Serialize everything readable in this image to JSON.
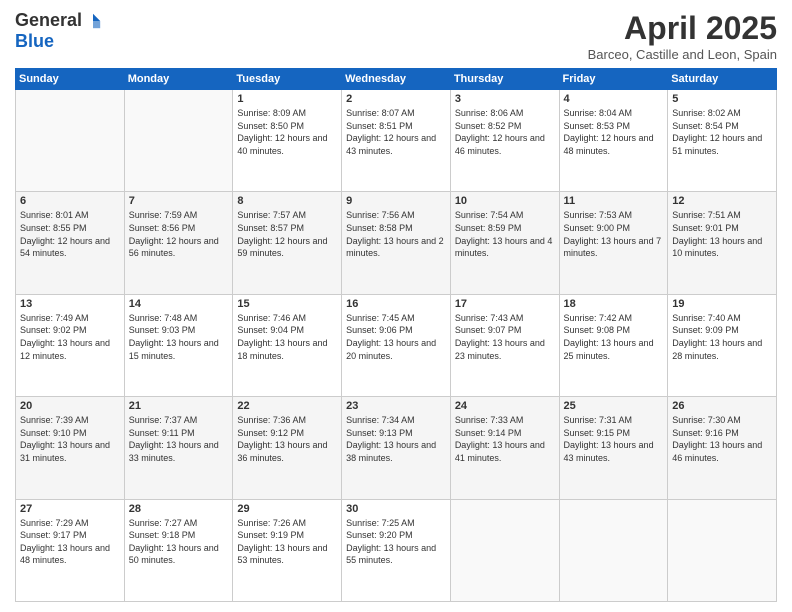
{
  "header": {
    "logo_general": "General",
    "logo_blue": "Blue",
    "title": "April 2025",
    "location": "Barceo, Castille and Leon, Spain"
  },
  "days_of_week": [
    "Sunday",
    "Monday",
    "Tuesday",
    "Wednesday",
    "Thursday",
    "Friday",
    "Saturday"
  ],
  "weeks": [
    [
      {
        "day": "",
        "info": ""
      },
      {
        "day": "",
        "info": ""
      },
      {
        "day": "1",
        "info": "Sunrise: 8:09 AM\nSunset: 8:50 PM\nDaylight: 12 hours and 40 minutes."
      },
      {
        "day": "2",
        "info": "Sunrise: 8:07 AM\nSunset: 8:51 PM\nDaylight: 12 hours and 43 minutes."
      },
      {
        "day": "3",
        "info": "Sunrise: 8:06 AM\nSunset: 8:52 PM\nDaylight: 12 hours and 46 minutes."
      },
      {
        "day": "4",
        "info": "Sunrise: 8:04 AM\nSunset: 8:53 PM\nDaylight: 12 hours and 48 minutes."
      },
      {
        "day": "5",
        "info": "Sunrise: 8:02 AM\nSunset: 8:54 PM\nDaylight: 12 hours and 51 minutes."
      }
    ],
    [
      {
        "day": "6",
        "info": "Sunrise: 8:01 AM\nSunset: 8:55 PM\nDaylight: 12 hours and 54 minutes."
      },
      {
        "day": "7",
        "info": "Sunrise: 7:59 AM\nSunset: 8:56 PM\nDaylight: 12 hours and 56 minutes."
      },
      {
        "day": "8",
        "info": "Sunrise: 7:57 AM\nSunset: 8:57 PM\nDaylight: 12 hours and 59 minutes."
      },
      {
        "day": "9",
        "info": "Sunrise: 7:56 AM\nSunset: 8:58 PM\nDaylight: 13 hours and 2 minutes."
      },
      {
        "day": "10",
        "info": "Sunrise: 7:54 AM\nSunset: 8:59 PM\nDaylight: 13 hours and 4 minutes."
      },
      {
        "day": "11",
        "info": "Sunrise: 7:53 AM\nSunset: 9:00 PM\nDaylight: 13 hours and 7 minutes."
      },
      {
        "day": "12",
        "info": "Sunrise: 7:51 AM\nSunset: 9:01 PM\nDaylight: 13 hours and 10 minutes."
      }
    ],
    [
      {
        "day": "13",
        "info": "Sunrise: 7:49 AM\nSunset: 9:02 PM\nDaylight: 13 hours and 12 minutes."
      },
      {
        "day": "14",
        "info": "Sunrise: 7:48 AM\nSunset: 9:03 PM\nDaylight: 13 hours and 15 minutes."
      },
      {
        "day": "15",
        "info": "Sunrise: 7:46 AM\nSunset: 9:04 PM\nDaylight: 13 hours and 18 minutes."
      },
      {
        "day": "16",
        "info": "Sunrise: 7:45 AM\nSunset: 9:06 PM\nDaylight: 13 hours and 20 minutes."
      },
      {
        "day": "17",
        "info": "Sunrise: 7:43 AM\nSunset: 9:07 PM\nDaylight: 13 hours and 23 minutes."
      },
      {
        "day": "18",
        "info": "Sunrise: 7:42 AM\nSunset: 9:08 PM\nDaylight: 13 hours and 25 minutes."
      },
      {
        "day": "19",
        "info": "Sunrise: 7:40 AM\nSunset: 9:09 PM\nDaylight: 13 hours and 28 minutes."
      }
    ],
    [
      {
        "day": "20",
        "info": "Sunrise: 7:39 AM\nSunset: 9:10 PM\nDaylight: 13 hours and 31 minutes."
      },
      {
        "day": "21",
        "info": "Sunrise: 7:37 AM\nSunset: 9:11 PM\nDaylight: 13 hours and 33 minutes."
      },
      {
        "day": "22",
        "info": "Sunrise: 7:36 AM\nSunset: 9:12 PM\nDaylight: 13 hours and 36 minutes."
      },
      {
        "day": "23",
        "info": "Sunrise: 7:34 AM\nSunset: 9:13 PM\nDaylight: 13 hours and 38 minutes."
      },
      {
        "day": "24",
        "info": "Sunrise: 7:33 AM\nSunset: 9:14 PM\nDaylight: 13 hours and 41 minutes."
      },
      {
        "day": "25",
        "info": "Sunrise: 7:31 AM\nSunset: 9:15 PM\nDaylight: 13 hours and 43 minutes."
      },
      {
        "day": "26",
        "info": "Sunrise: 7:30 AM\nSunset: 9:16 PM\nDaylight: 13 hours and 46 minutes."
      }
    ],
    [
      {
        "day": "27",
        "info": "Sunrise: 7:29 AM\nSunset: 9:17 PM\nDaylight: 13 hours and 48 minutes."
      },
      {
        "day": "28",
        "info": "Sunrise: 7:27 AM\nSunset: 9:18 PM\nDaylight: 13 hours and 50 minutes."
      },
      {
        "day": "29",
        "info": "Sunrise: 7:26 AM\nSunset: 9:19 PM\nDaylight: 13 hours and 53 minutes."
      },
      {
        "day": "30",
        "info": "Sunrise: 7:25 AM\nSunset: 9:20 PM\nDaylight: 13 hours and 55 minutes."
      },
      {
        "day": "",
        "info": ""
      },
      {
        "day": "",
        "info": ""
      },
      {
        "day": "",
        "info": ""
      }
    ]
  ]
}
